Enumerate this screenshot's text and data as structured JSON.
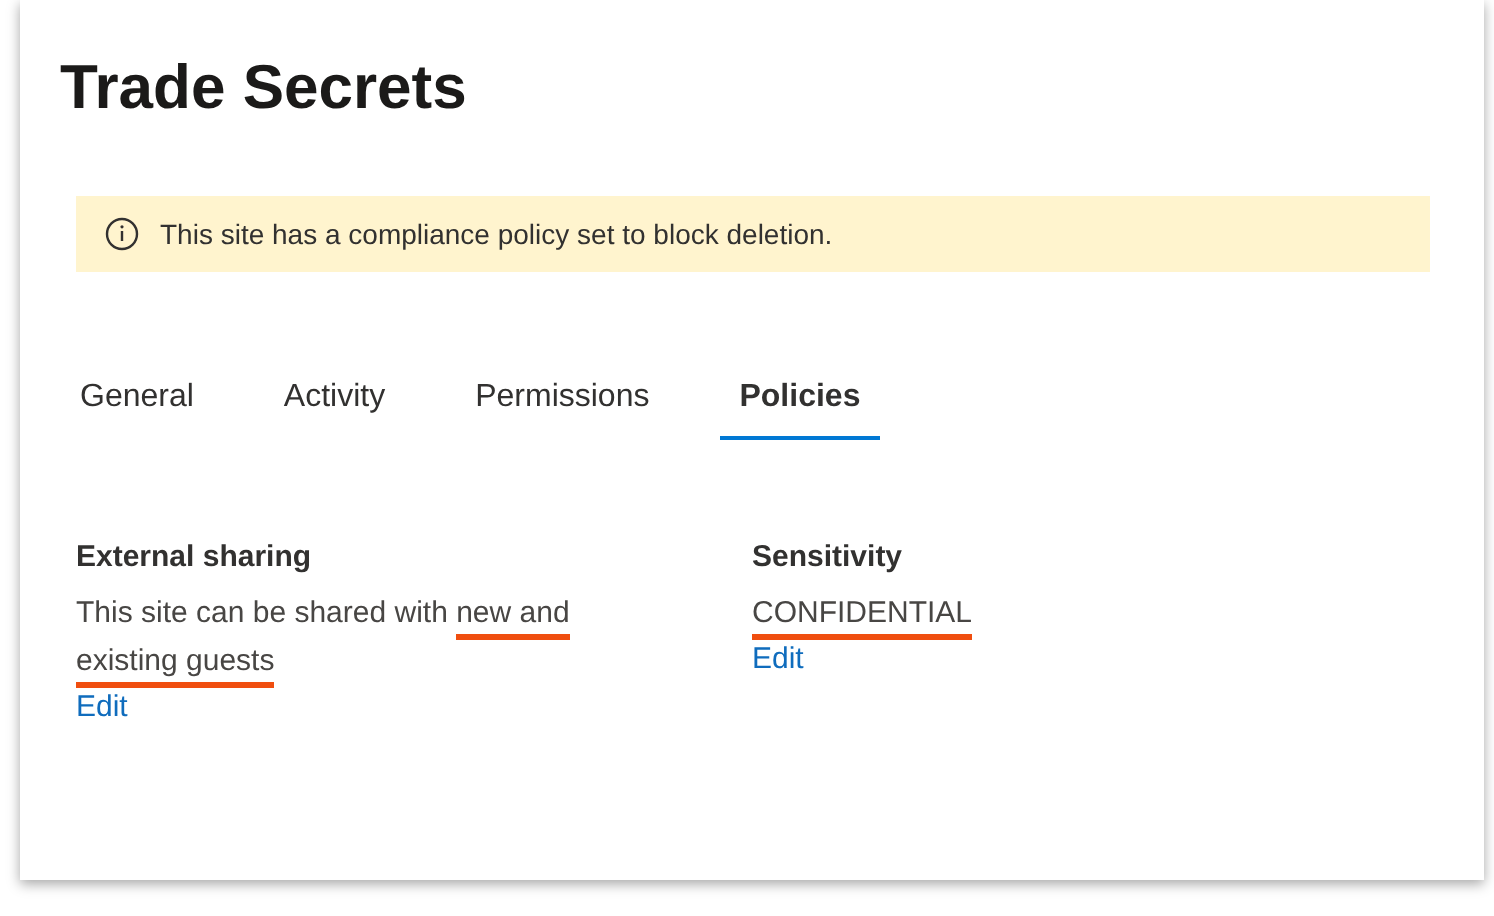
{
  "title": "Trade Secrets",
  "banner": {
    "text": "This site has a compliance policy set to block deletion."
  },
  "tabs": [
    {
      "label": "General",
      "selected": false
    },
    {
      "label": "Activity",
      "selected": false
    },
    {
      "label": "Permissions",
      "selected": false
    },
    {
      "label": "Policies",
      "selected": true
    }
  ],
  "sections": [
    {
      "heading": "External sharing",
      "parts": [
        {
          "text": "This site can be shared with ",
          "highlighted": false
        },
        {
          "text": "new and existing guests",
          "highlighted": true
        }
      ],
      "link": "Edit"
    },
    {
      "heading": "Sensitivity",
      "parts": [
        {
          "text": "CONFIDENTIAL",
          "highlighted": true
        }
      ],
      "link": "Edit"
    }
  ]
}
